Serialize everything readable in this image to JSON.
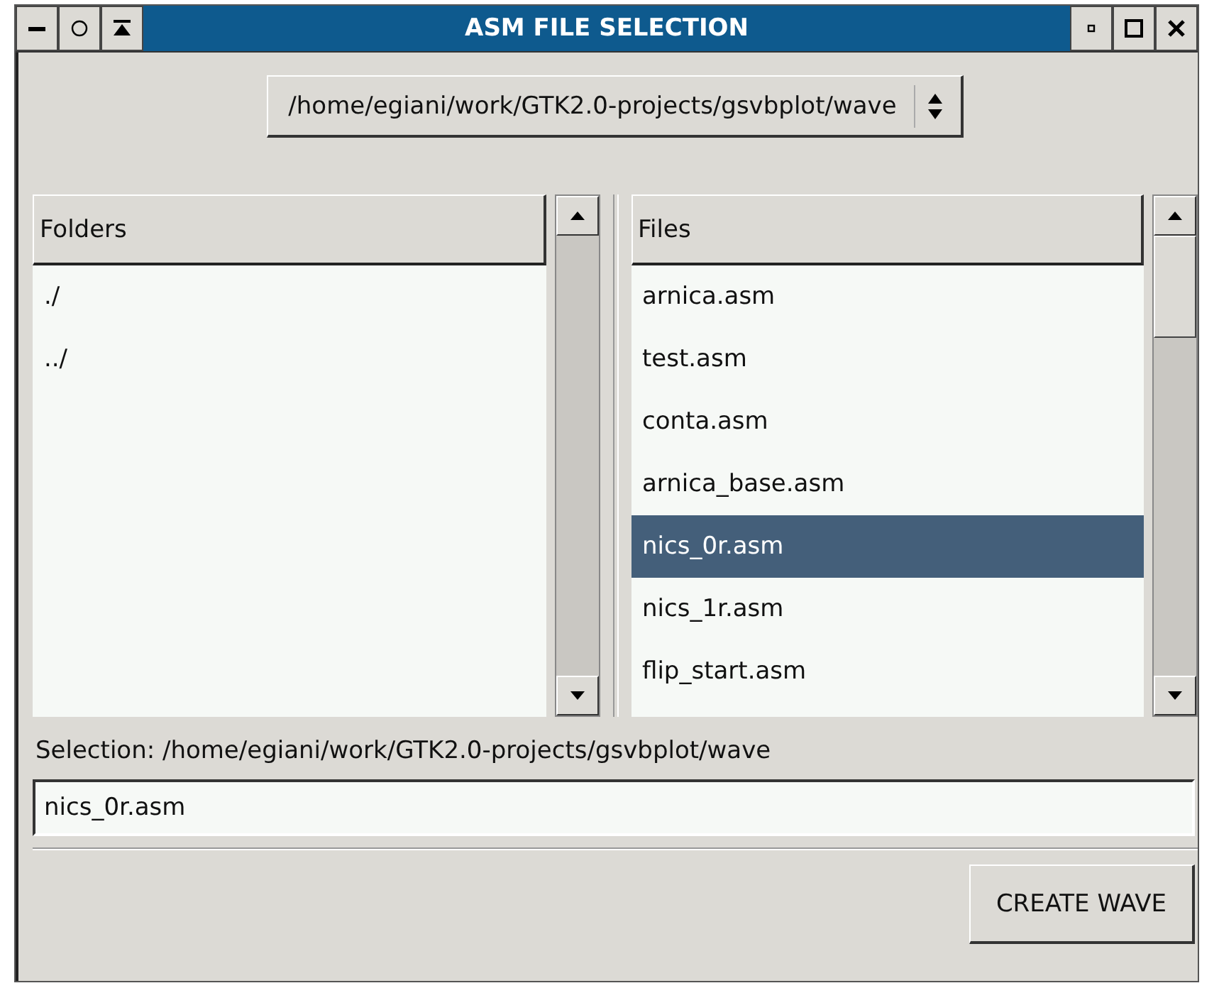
{
  "window": {
    "title": "ASM FILE SELECTION"
  },
  "path_dropdown": {
    "value": "/home/egiani/work/GTK2.0-projects/gsvbplot/wave"
  },
  "folders": {
    "heading": "Folders",
    "items": [
      {
        "name": "./",
        "selected": false
      },
      {
        "name": "../",
        "selected": false
      }
    ]
  },
  "files": {
    "heading": "Files",
    "items": [
      {
        "name": "arnica.asm",
        "selected": false
      },
      {
        "name": "test.asm",
        "selected": false
      },
      {
        "name": "conta.asm",
        "selected": false
      },
      {
        "name": "arnica_base.asm",
        "selected": false
      },
      {
        "name": "nics_0r.asm",
        "selected": true
      },
      {
        "name": "nics_1r.asm",
        "selected": false
      },
      {
        "name": "flip_start.asm",
        "selected": false
      }
    ]
  },
  "selection_label": "Selection: /home/egiani/work/GTK2.0-projects/gsvbplot/wave",
  "filename_field": {
    "value": "nics_0r.asm"
  },
  "buttons": [
    "CREATE WAVE"
  ]
}
